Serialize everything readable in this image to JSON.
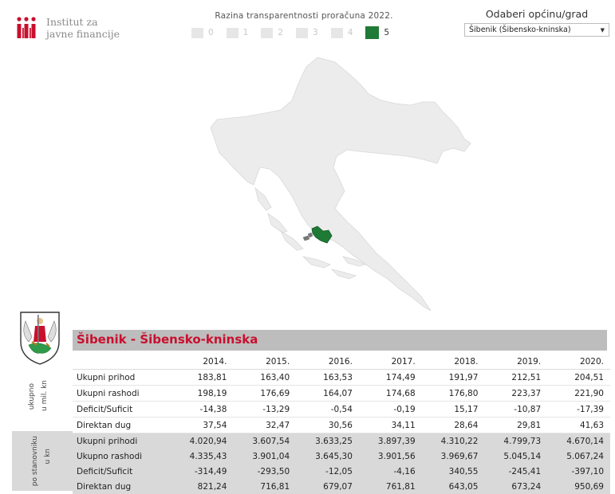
{
  "logo": {
    "line1": "Institut za",
    "line2": "javne financije"
  },
  "legend": {
    "title": "Razina transparentnosti proračuna 2022.",
    "levels": [
      "0",
      "1",
      "2",
      "3",
      "4",
      "5"
    ],
    "active": "5",
    "active_color": "#1f7a35"
  },
  "selector": {
    "label": "Odaberi općinu/grad",
    "value": "Šibenik (Šibensko-kninska)"
  },
  "city": {
    "title": "Šibenik - Šibensko-kninska",
    "title_color": "#c8102e"
  },
  "table": {
    "years": [
      "2014.",
      "2015.",
      "2016.",
      "2017.",
      "2018.",
      "2019.",
      "2020."
    ],
    "groups": [
      {
        "label_line1": "ukupno",
        "label_line2": "u mil. kn",
        "rows": [
          {
            "label": "Ukupni prihod",
            "values": [
              "183,81",
              "163,40",
              "163,53",
              "174,49",
              "191,97",
              "212,51",
              "204,51"
            ]
          },
          {
            "label": "Ukupni rashodi",
            "values": [
              "198,19",
              "176,69",
              "164,07",
              "174,68",
              "176,80",
              "223,37",
              "221,90"
            ]
          },
          {
            "label": "Deficit/Suficit",
            "values": [
              "-14,38",
              "-13,29",
              "-0,54",
              "-0,19",
              "15,17",
              "-10,87",
              "-17,39"
            ]
          },
          {
            "label": "Direktan dug",
            "values": [
              "37,54",
              "32,47",
              "30,56",
              "34,11",
              "28,64",
              "29,81",
              "41,63"
            ]
          }
        ]
      },
      {
        "label_line1": "po stanovniku",
        "label_line2": "u kn",
        "rows": [
          {
            "label": "Ukupni prihodi",
            "values": [
              "4.020,94",
              "3.607,54",
              "3.633,25",
              "3.897,39",
              "4.310,22",
              "4.799,73",
              "4.670,14"
            ]
          },
          {
            "label": "Ukupno rashodi",
            "values": [
              "4.335,43",
              "3.901,04",
              "3.645,30",
              "3.901,56",
              "3.969,67",
              "5.045,14",
              "5.067,24"
            ]
          },
          {
            "label": "Deficit/Suficit",
            "values": [
              "-314,49",
              "-293,50",
              "-12,05",
              "-4,16",
              "340,55",
              "-245,41",
              "-397,10"
            ]
          },
          {
            "label": "Direktan dug",
            "values": [
              "821,24",
              "716,81",
              "679,07",
              "761,81",
              "643,05",
              "673,24",
              "950,69"
            ]
          }
        ]
      }
    ]
  }
}
